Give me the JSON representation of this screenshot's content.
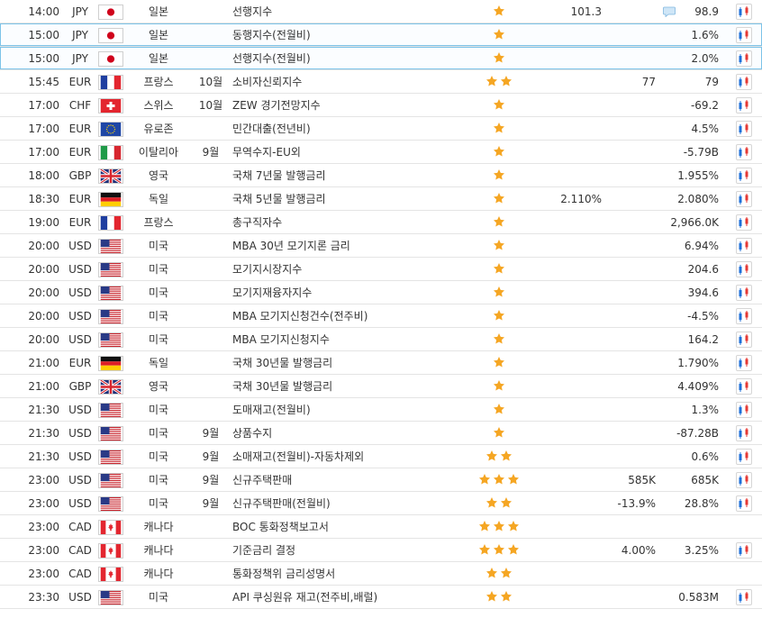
{
  "events": [
    {
      "time": "14:00",
      "currency": "JPY",
      "flag": "jp",
      "country": "일본",
      "period": "",
      "event": "선행지수",
      "stars": 1,
      "actual": "101.3",
      "forecast": "",
      "previous": "98.9",
      "comment": true,
      "chart": true,
      "highlight": false
    },
    {
      "time": "15:00",
      "currency": "JPY",
      "flag": "jp",
      "country": "일본",
      "period": "",
      "event": "동행지수(전월비)",
      "stars": 1,
      "actual": "",
      "forecast": "",
      "previous": "1.6%",
      "comment": false,
      "chart": true,
      "highlight": true
    },
    {
      "time": "15:00",
      "currency": "JPY",
      "flag": "jp",
      "country": "일본",
      "period": "",
      "event": "선행지수(전월비)",
      "stars": 1,
      "actual": "",
      "forecast": "",
      "previous": "2.0%",
      "comment": false,
      "chart": true,
      "highlight": true
    },
    {
      "time": "15:45",
      "currency": "EUR",
      "flag": "fr",
      "country": "프랑스",
      "period": "10월",
      "event": "소비자신뢰지수",
      "stars": 2,
      "actual": "",
      "forecast": "77",
      "previous": "79",
      "comment": false,
      "chart": true,
      "highlight": false
    },
    {
      "time": "17:00",
      "currency": "CHF",
      "flag": "ch",
      "country": "스위스",
      "period": "10월",
      "event": "ZEW 경기전망지수",
      "stars": 1,
      "actual": "",
      "forecast": "",
      "previous": "-69.2",
      "comment": false,
      "chart": true,
      "highlight": false
    },
    {
      "time": "17:00",
      "currency": "EUR",
      "flag": "eu",
      "country": "유로존",
      "period": "",
      "event": "민간대출(전년비)",
      "stars": 1,
      "actual": "",
      "forecast": "",
      "previous": "4.5%",
      "comment": false,
      "chart": true,
      "highlight": false
    },
    {
      "time": "17:00",
      "currency": "EUR",
      "flag": "it",
      "country": "이탈리아",
      "period": "9월",
      "event": "무역수지-EU외",
      "stars": 1,
      "actual": "",
      "forecast": "",
      "previous": "-5.79B",
      "comment": false,
      "chart": true,
      "highlight": false
    },
    {
      "time": "18:00",
      "currency": "GBP",
      "flag": "gb",
      "country": "영국",
      "period": "",
      "event": "국채 7년물 발행금리",
      "stars": 1,
      "actual": "",
      "forecast": "",
      "previous": "1.955%",
      "comment": false,
      "chart": true,
      "highlight": false
    },
    {
      "time": "18:30",
      "currency": "EUR",
      "flag": "de",
      "country": "독일",
      "period": "",
      "event": "국채 5년물 발행금리",
      "stars": 1,
      "actual": "2.110%",
      "forecast": "",
      "previous": "2.080%",
      "comment": false,
      "chart": true,
      "highlight": false
    },
    {
      "time": "19:00",
      "currency": "EUR",
      "flag": "fr",
      "country": "프랑스",
      "period": "",
      "event": "총구직자수",
      "stars": 1,
      "actual": "",
      "forecast": "",
      "previous": "2,966.0K",
      "comment": false,
      "chart": true,
      "highlight": false
    },
    {
      "time": "20:00",
      "currency": "USD",
      "flag": "us",
      "country": "미국",
      "period": "",
      "event": "MBA 30년 모기지론 금리",
      "stars": 1,
      "actual": "",
      "forecast": "",
      "previous": "6.94%",
      "comment": false,
      "chart": true,
      "highlight": false
    },
    {
      "time": "20:00",
      "currency": "USD",
      "flag": "us",
      "country": "미국",
      "period": "",
      "event": "모기지시장지수",
      "stars": 1,
      "actual": "",
      "forecast": "",
      "previous": "204.6",
      "comment": false,
      "chart": true,
      "highlight": false
    },
    {
      "time": "20:00",
      "currency": "USD",
      "flag": "us",
      "country": "미국",
      "period": "",
      "event": "모기지재융자지수",
      "stars": 1,
      "actual": "",
      "forecast": "",
      "previous": "394.6",
      "comment": false,
      "chart": true,
      "highlight": false
    },
    {
      "time": "20:00",
      "currency": "USD",
      "flag": "us",
      "country": "미국",
      "period": "",
      "event": "MBA 모기지신청건수(전주비)",
      "stars": 1,
      "actual": "",
      "forecast": "",
      "previous": "-4.5%",
      "comment": false,
      "chart": true,
      "highlight": false
    },
    {
      "time": "20:00",
      "currency": "USD",
      "flag": "us",
      "country": "미국",
      "period": "",
      "event": "MBA 모기지신청지수",
      "stars": 1,
      "actual": "",
      "forecast": "",
      "previous": "164.2",
      "comment": false,
      "chart": true,
      "highlight": false
    },
    {
      "time": "21:00",
      "currency": "EUR",
      "flag": "de",
      "country": "독일",
      "period": "",
      "event": "국채 30년물 발행금리",
      "stars": 1,
      "actual": "",
      "forecast": "",
      "previous": "1.790%",
      "comment": false,
      "chart": true,
      "highlight": false
    },
    {
      "time": "21:00",
      "currency": "GBP",
      "flag": "gb",
      "country": "영국",
      "period": "",
      "event": "국채 30년물 발행금리",
      "stars": 1,
      "actual": "",
      "forecast": "",
      "previous": "4.409%",
      "comment": false,
      "chart": true,
      "highlight": false
    },
    {
      "time": "21:30",
      "currency": "USD",
      "flag": "us",
      "country": "미국",
      "period": "",
      "event": "도매재고(전월비)",
      "stars": 1,
      "actual": "",
      "forecast": "",
      "previous": "1.3%",
      "comment": false,
      "chart": true,
      "highlight": false
    },
    {
      "time": "21:30",
      "currency": "USD",
      "flag": "us",
      "country": "미국",
      "period": "9월",
      "event": "상품수지",
      "stars": 1,
      "actual": "",
      "forecast": "",
      "previous": "-87.28B",
      "comment": false,
      "chart": true,
      "highlight": false
    },
    {
      "time": "21:30",
      "currency": "USD",
      "flag": "us",
      "country": "미국",
      "period": "9월",
      "event": "소매재고(전월비)-자동차제외",
      "stars": 2,
      "actual": "",
      "forecast": "",
      "previous": "0.6%",
      "comment": false,
      "chart": true,
      "highlight": false
    },
    {
      "time": "23:00",
      "currency": "USD",
      "flag": "us",
      "country": "미국",
      "period": "9월",
      "event": "신규주택판매",
      "stars": 3,
      "actual": "",
      "forecast": "585K",
      "previous": "685K",
      "comment": false,
      "chart": true,
      "highlight": false
    },
    {
      "time": "23:00",
      "currency": "USD",
      "flag": "us",
      "country": "미국",
      "period": "9월",
      "event": "신규주택판매(전월비)",
      "stars": 2,
      "actual": "",
      "forecast": "-13.9%",
      "previous": "28.8%",
      "comment": false,
      "chart": true,
      "highlight": false
    },
    {
      "time": "23:00",
      "currency": "CAD",
      "flag": "ca",
      "country": "캐나다",
      "period": "",
      "event": "BOC 통화정책보고서",
      "stars": 3,
      "actual": "",
      "forecast": "",
      "previous": "",
      "comment": false,
      "chart": false,
      "highlight": false
    },
    {
      "time": "23:00",
      "currency": "CAD",
      "flag": "ca",
      "country": "캐나다",
      "period": "",
      "event": "기준금리 결정",
      "stars": 3,
      "actual": "",
      "forecast": "4.00%",
      "previous": "3.25%",
      "comment": false,
      "chart": true,
      "highlight": false
    },
    {
      "time": "23:00",
      "currency": "CAD",
      "flag": "ca",
      "country": "캐나다",
      "period": "",
      "event": "통화정책위 금리성명서",
      "stars": 2,
      "actual": "",
      "forecast": "",
      "previous": "",
      "comment": false,
      "chart": false,
      "highlight": false
    },
    {
      "time": "23:30",
      "currency": "USD",
      "flag": "us",
      "country": "미국",
      "period": "",
      "event": "API 쿠싱원유 재고(전주비,배럴)",
      "stars": 2,
      "actual": "",
      "forecast": "",
      "previous": "0.583M",
      "comment": false,
      "chart": true,
      "highlight": false
    }
  ],
  "icons": {
    "importance": "star-icon",
    "comment": "comment-icon",
    "chart": "chart-icon"
  },
  "colors": {
    "star": "#f5a623",
    "row_border": "#e4e4e4",
    "highlight_border": "#7cc3e8",
    "chart_red": "#e53935",
    "chart_blue": "#1e6fd9"
  }
}
